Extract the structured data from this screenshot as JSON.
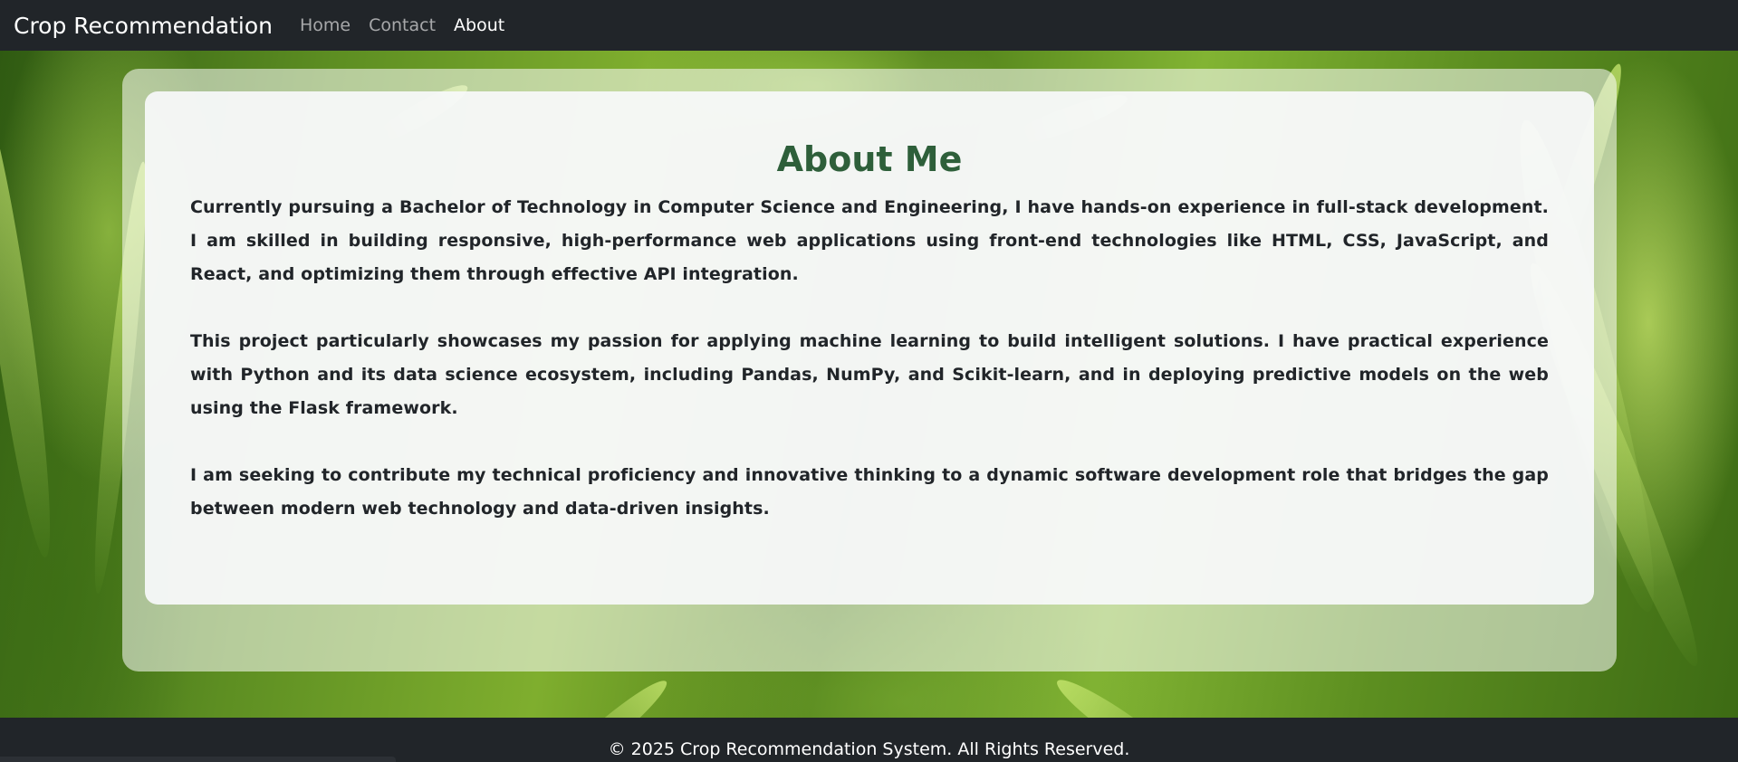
{
  "navbar": {
    "brand": "Crop Recommendation",
    "links": [
      {
        "label": "Home"
      },
      {
        "label": "Contact"
      },
      {
        "label": "About"
      }
    ]
  },
  "about": {
    "title": "About Me",
    "paragraphs": [
      "Currently pursuing a Bachelor of Technology in Computer Science and Engineering, I have hands-on experience in full-stack development. I am skilled in building responsive, high-performance web applications using front-end technologies like HTML, CSS, JavaScript, and React, and optimizing them through effective API integration.",
      "This project particularly showcases my passion for applying machine learning to build intelligent solutions. I have practical experience with Python and its data science ecosystem, including Pandas, NumPy, and Scikit-learn, and in deploying predictive models on the web using the Flask framework.",
      "I am seeking to contribute my technical proficiency and innovative thinking to a dynamic software development role that bridges the gap between modern web technology and data-driven insights."
    ]
  },
  "footer": {
    "text": "© 2025 Crop Recommendation System. All Rights Reserved."
  },
  "colors": {
    "navbar_bg": "#212529",
    "title_green": "#2e5f3a",
    "card_bg": "#f8f9fa"
  }
}
